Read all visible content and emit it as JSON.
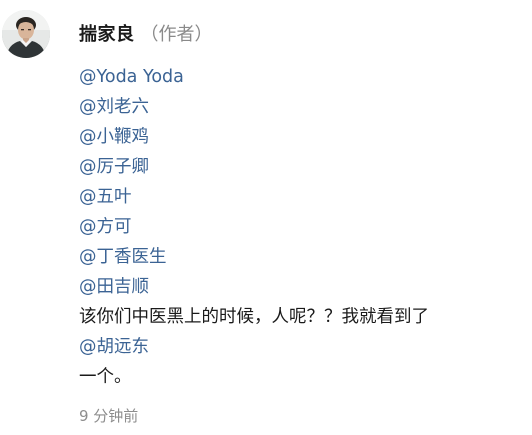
{
  "comment": {
    "author": {
      "name": "揣家良",
      "role": "（作者）"
    },
    "lines": [
      {
        "text": "@Yoda Yoda",
        "kind": "mention"
      },
      {
        "text": "@刘老六",
        "kind": "mention"
      },
      {
        "text": "@小鞭鸡",
        "kind": "mention"
      },
      {
        "text": "@厉子卿",
        "kind": "mention"
      },
      {
        "text": "@五叶",
        "kind": "mention"
      },
      {
        "text": "@方可",
        "kind": "mention"
      },
      {
        "text": "@丁香医生",
        "kind": "mention"
      },
      {
        "text": "@田吉顺",
        "kind": "mention"
      },
      {
        "text": "该你们中医黑上的时候，人呢？？我就看到了",
        "kind": "plain"
      },
      {
        "text": "@胡远东",
        "kind": "mention"
      },
      {
        "text": "一个。",
        "kind": "plain"
      }
    ],
    "timestamp": "9 分钟前"
  },
  "colors": {
    "mention": "#3b6394",
    "text": "#1a1a1a",
    "muted": "#8d8d8d"
  },
  "icons": {
    "avatar": "user-avatar-photo"
  }
}
